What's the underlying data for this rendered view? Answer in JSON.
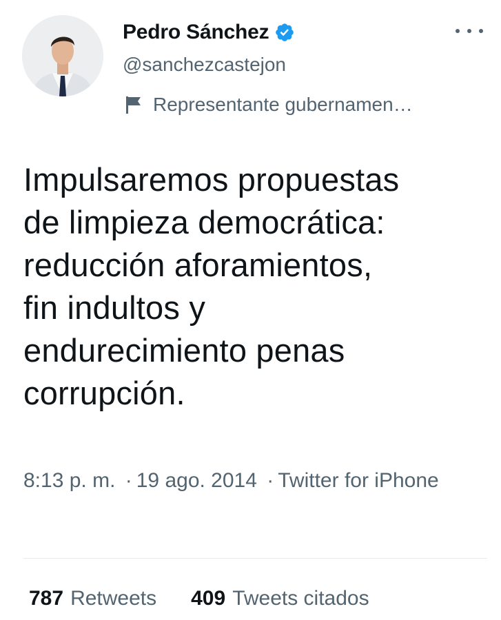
{
  "user": {
    "name": "Pedro Sánchez",
    "handle": "@sanchezcastejon",
    "label": "Representante gubernamen…",
    "verified": true
  },
  "tweet": {
    "text": "Impulsaremos propuestas\nde limpieza democrática:\nreducción aforamientos,\nfin indultos y\nendurecimiento penas\ncorrupción.",
    "time": "8:13 p. m.",
    "date": "19 ago. 2014",
    "separator": "·",
    "source": "Twitter for iPhone"
  },
  "stats": {
    "retweets_count": "787",
    "retweets_label": "Retweets",
    "quotes_count": "409",
    "quotes_label": "Tweets citados"
  },
  "colors": {
    "verified": "#1d9bf0",
    "secondary_text": "#536471",
    "primary_text": "#0f1419"
  },
  "icons": {
    "more": "more-dots-icon",
    "verified": "verified-badge-icon",
    "label": "flag-icon"
  }
}
